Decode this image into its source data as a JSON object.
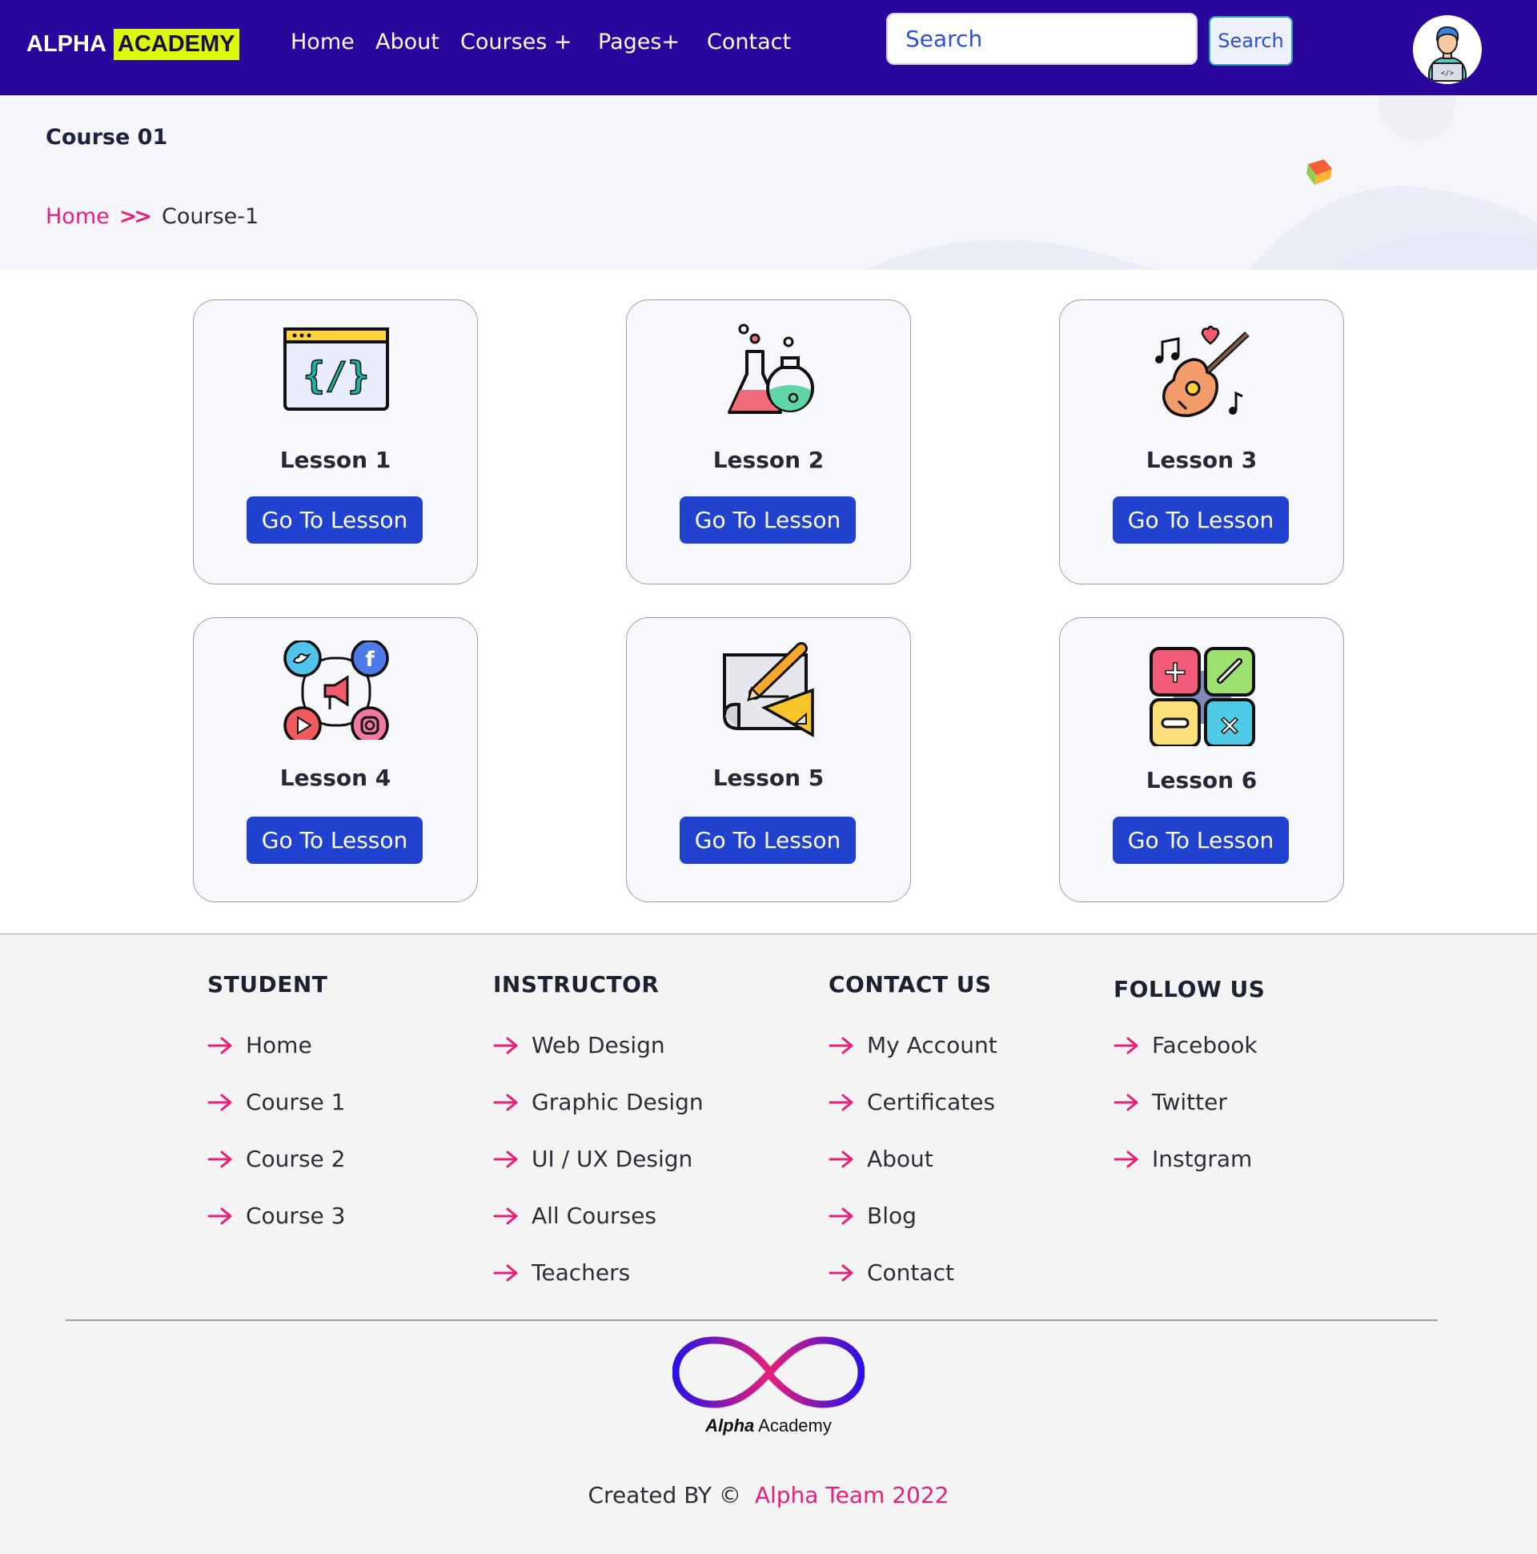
{
  "navbar": {
    "brand_part1": "ALPHA",
    "brand_part2": "ACADEMY",
    "links": [
      "Home",
      "About",
      "Courses +",
      "Pages+",
      "Contact"
    ],
    "search_placeholder": "Search",
    "search_button": "Search"
  },
  "banner": {
    "title": "Course 01",
    "breadcrumb_home": "Home",
    "breadcrumb_separator": ">>",
    "breadcrumb_current": "Course-1"
  },
  "lessons": [
    {
      "title": "Lesson 1",
      "button": "Go To Lesson",
      "icon": "code-window-icon"
    },
    {
      "title": "Lesson 2",
      "button": "Go To Lesson",
      "icon": "chemistry-flasks-icon"
    },
    {
      "title": "Lesson 3",
      "button": "Go To Lesson",
      "icon": "guitar-music-icon"
    },
    {
      "title": "Lesson 4",
      "button": "Go To Lesson",
      "icon": "social-media-icon"
    },
    {
      "title": "Lesson 5",
      "button": "Go To Lesson",
      "icon": "drawing-blueprint-icon"
    },
    {
      "title": "Lesson 6",
      "button": "Go To Lesson",
      "icon": "math-calculator-icon"
    }
  ],
  "footer": {
    "columns": [
      {
        "heading": "STUDENT",
        "links": [
          "Home",
          "Course 1",
          "Course 2",
          "Course 3"
        ]
      },
      {
        "heading": "INSTRUCTOR",
        "links": [
          "Web Design",
          "Graphic Design",
          "UI / UX Design",
          "All Courses",
          "Teachers"
        ]
      },
      {
        "heading": "CONTACT US",
        "links": [
          "My Account",
          "Certificates",
          "About",
          "Blog",
          "Contact"
        ]
      },
      {
        "heading": "FOLLOW US",
        "links": [
          "Facebook",
          "Twitter",
          "Instgram"
        ]
      }
    ],
    "logo_text_bold": "Alpha",
    "logo_text": "Academy",
    "credit_prefix": "Created BY ©",
    "credit_team": "Alpha Team 2022"
  },
  "colors": {
    "navbar_bg": "#2a069c",
    "brand_highlight": "#ddf90a",
    "accent_pink": "#e81f7a",
    "button_blue": "#2141cf"
  }
}
